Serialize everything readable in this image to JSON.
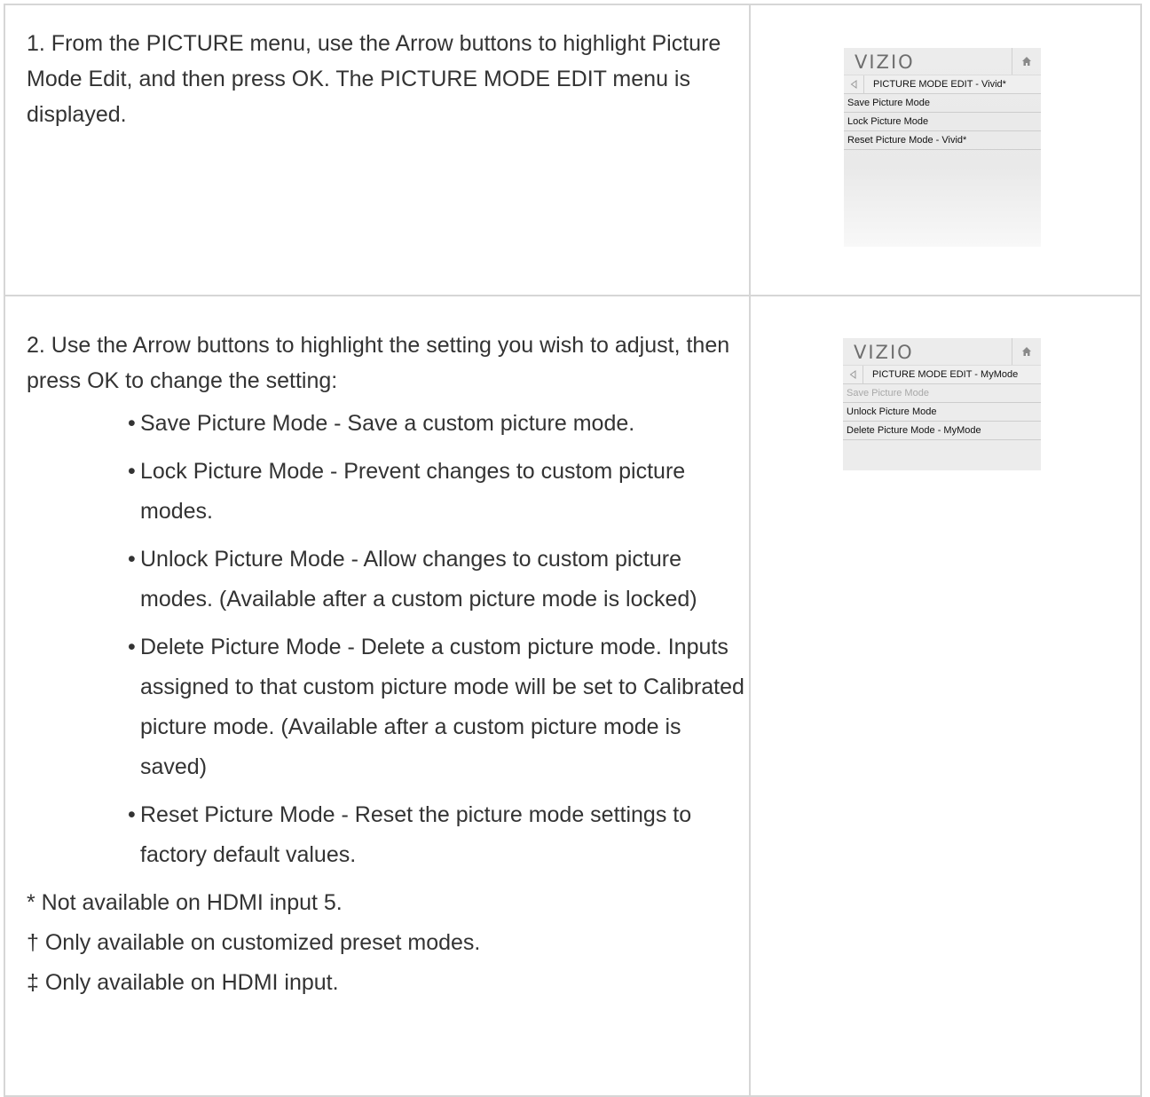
{
  "steps": [
    {
      "text": "1. From the PICTURE menu, use the Arrow buttons to highlight Picture Mode Edit, and then press OK. The PICTURE MODE EDIT menu is displayed.",
      "menu": {
        "logo": "VIZIO",
        "home_icon": "home-icon",
        "back_icon": "back-arrow-icon",
        "title": "PICTURE MODE EDIT - Vivid*",
        "items": [
          {
            "label": "Save Picture Mode",
            "state": "enabled"
          },
          {
            "label": "Lock Picture Mode",
            "state": "enabled"
          },
          {
            "label": "Reset Picture Mode - Vivid*",
            "state": "enabled"
          }
        ]
      }
    },
    {
      "intro": "2. Use the Arrow buttons to highlight the setting you wish to adjust, then press OK to change the setting:",
      "bullets": [
        "Save Picture Mode - Save a custom picture mode.",
        "Lock Picture Mode - Prevent changes to custom picture modes.",
        "Unlock Picture Mode - Allow changes to custom picture modes. (Available after a custom picture mode is locked)",
        "Delete Picture Mode - Delete a custom picture mode. Inputs assigned to that custom picture mode will be set to Calibrated picture mode. (Available after a custom picture mode is saved)",
        "Reset Picture Mode - Reset the picture mode settings to factory default values."
      ],
      "notes": [
        "* Not available on HDMI input 5.",
        "† Only available on customized preset modes.",
        "‡ Only available on HDMI input."
      ],
      "menu": {
        "logo": "VIZIO",
        "home_icon": "home-icon",
        "back_icon": "back-arrow-icon",
        "title": "PICTURE MODE EDIT - MyMode",
        "items": [
          {
            "label": "Save Picture Mode",
            "state": "disabled"
          },
          {
            "label": "Unlock Picture Mode",
            "state": "enabled"
          },
          {
            "label": "Delete Picture Mode - MyMode",
            "state": "enabled"
          }
        ]
      }
    }
  ]
}
